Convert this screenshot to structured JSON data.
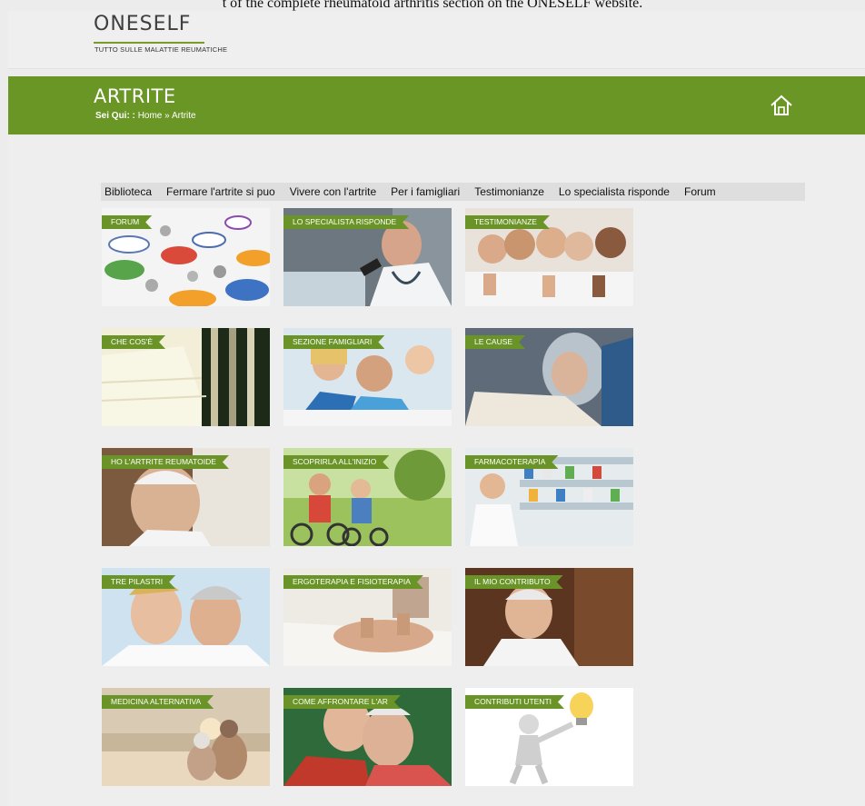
{
  "caption": "t of the complete rheumatoid arthritis section on the ONESELF website.",
  "site": {
    "logo": "ONESELF",
    "tagline": "TUTTO SULLE MALATTIE REUMATICHE"
  },
  "banner": {
    "title": "ARTRITE",
    "breadcrumb_prefix": "Sei Qui: :",
    "breadcrumb_home": "Home",
    "breadcrumb_sep": "»",
    "breadcrumb_current": "Artrite",
    "color": "#6a9626"
  },
  "menu": [
    "Biblioteca",
    "Fermare l'artrite si puo",
    "Vivere con l'artrite",
    "Per i famigliari",
    "Testimonianze",
    "Lo specialista risponde",
    "Forum"
  ],
  "tiles": [
    {
      "label": "FORUM",
      "icon": "speech-bubbles-image"
    },
    {
      "label": "LO SPECIALISTA RISPONDE",
      "icon": "doctor-image"
    },
    {
      "label": "TESTIMONIANZE",
      "icon": "thumbs-up-group-image"
    },
    {
      "label": "CHE COS'È",
      "icon": "book-pages-image"
    },
    {
      "label": "SEZIONE FAMIGLIARI",
      "icon": "family-image"
    },
    {
      "label": "LE CAUSE",
      "icon": "elderly-reading-image"
    },
    {
      "label": "HO L'ARTRITE REUMATOIDE",
      "icon": "elderly-man-image"
    },
    {
      "label": "SCOPRIRLA ALL'INIZIO",
      "icon": "cycling-image"
    },
    {
      "label": "FARMACOTERAPIA",
      "icon": "pharmacy-image"
    },
    {
      "label": "TRE PILASTRI",
      "icon": "couple-image"
    },
    {
      "label": "ERGOTERAPIA E FISIOTERAPIA",
      "icon": "physio-image"
    },
    {
      "label": "IL MIO CONTRIBUTO",
      "icon": "senior-smiling-image"
    },
    {
      "label": "MEDICINA ALTERNATIVA",
      "icon": "beach-image"
    },
    {
      "label": "COME AFFRONTARE L'AR",
      "icon": "hug-image"
    },
    {
      "label": "CONTRIBUTI UTENTI",
      "icon": "lightbulb-figure-image"
    }
  ]
}
